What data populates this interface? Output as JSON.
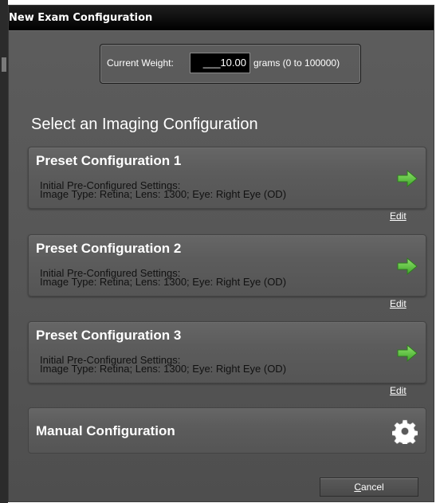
{
  "dialog": {
    "title": "New Exam Configuration"
  },
  "weight": {
    "label": "Current Weight:",
    "value": "___10.00",
    "units": "grams (0 to 100000)"
  },
  "section_title": "Select an Imaging Configuration",
  "presets": [
    {
      "title": "Preset Configuration 1",
      "line1": "Initial Pre-Configured Settings:",
      "line2": "Image Type: Retina; Lens: 1300; Eye: Right Eye (OD)",
      "edit": "Edit",
      "icon": "green-arrow-icon"
    },
    {
      "title": "Preset Configuration 2",
      "line1": "Initial Pre-Configured Settings:",
      "line2": "Image Type: Retina; Lens: 1300; Eye: Right Eye (OD)",
      "edit": "Edit",
      "icon": "green-arrow-icon"
    },
    {
      "title": "Preset Configuration 3",
      "line1": "Initial Pre-Configured Settings:",
      "line2": "Image Type: Retina; Lens: 1300; Eye: Right Eye (OD)",
      "edit": "Edit",
      "icon": "green-arrow-icon"
    }
  ],
  "manual": {
    "title": "Manual Configuration",
    "icon": "gear-icon"
  },
  "buttons": {
    "cancel_mnemonic": "C",
    "cancel_rest": "ancel"
  },
  "colors": {
    "arrow": "#5cc43a",
    "panel": "#5a5a5a",
    "titlebar": "#000000"
  }
}
